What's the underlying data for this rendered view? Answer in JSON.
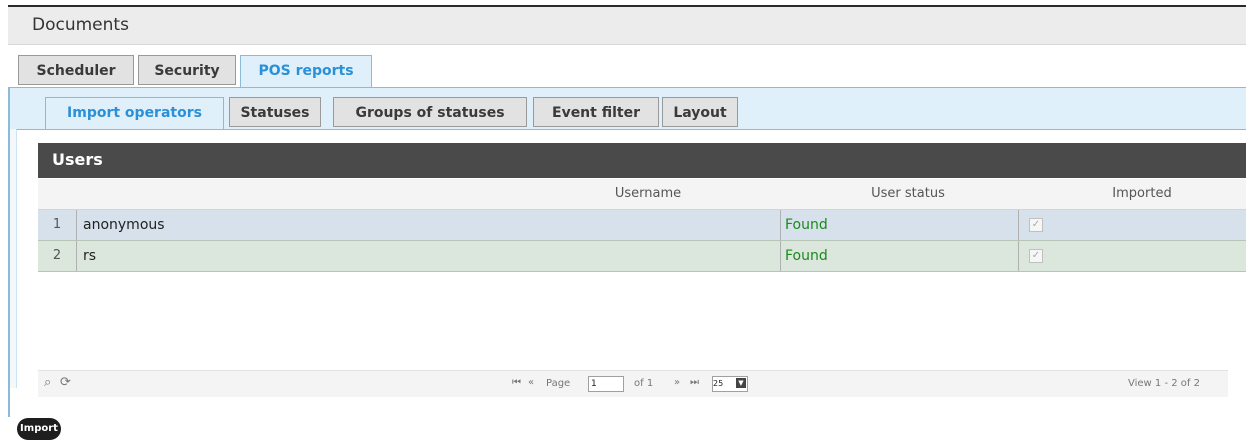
{
  "header": {
    "title": "Documents"
  },
  "tabs_main": [
    {
      "label": "Scheduler"
    },
    {
      "label": "Security"
    },
    {
      "label": "POS reports"
    }
  ],
  "tabs_sub": [
    {
      "label": "Import operators"
    },
    {
      "label": "Statuses"
    },
    {
      "label": "Groups of statuses"
    },
    {
      "label": "Event filter"
    },
    {
      "label": "Layout"
    }
  ],
  "grid": {
    "title": "Users",
    "columns": {
      "username": "Username",
      "status": "User status",
      "imported": "Imported"
    },
    "rows": [
      {
        "num": "1",
        "username": "anonymous",
        "status": "Found",
        "imported": true
      },
      {
        "num": "2",
        "username": "rs",
        "status": "Found",
        "imported": true
      }
    ]
  },
  "pager": {
    "first": "⏮",
    "prev": "«",
    "page_label": "Page",
    "page_value": "1",
    "of_label": "of 1",
    "next": "»",
    "last": "⏭",
    "per_page": "25",
    "view_text": "View 1 - 2 of 2",
    "search_icon": "⌕",
    "refresh_icon": "⟳"
  },
  "actions": {
    "import_label": "Import"
  },
  "colors": {
    "accent": "#2a90d8",
    "status_found": "#1a8a1a",
    "grid_title_bg": "#4a4a4a"
  }
}
